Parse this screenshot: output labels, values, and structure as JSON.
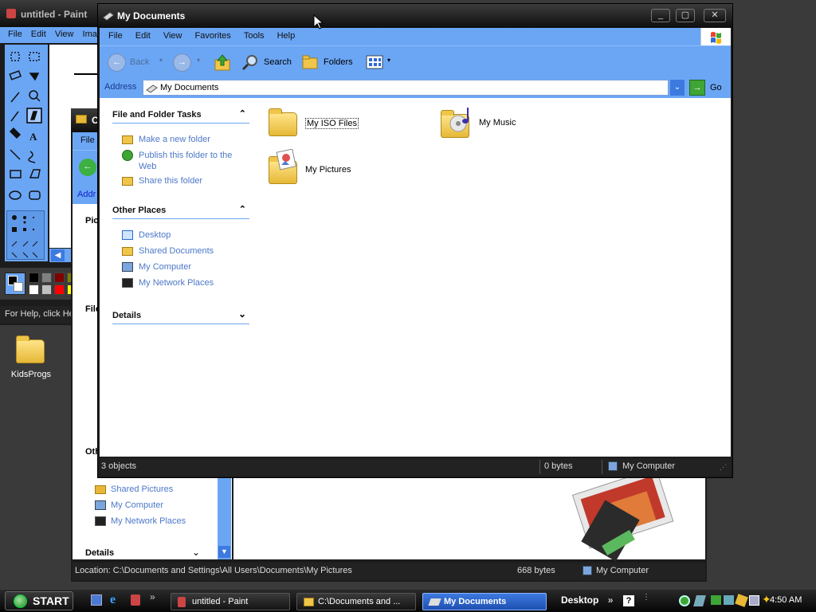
{
  "desktop": {
    "icon_label": "KidsProgs"
  },
  "paint": {
    "title": "untitled - Paint",
    "menu": [
      "File",
      "Edit",
      "View",
      "Ima"
    ],
    "status": "For Help, click He"
  },
  "back_window": {
    "title": "C",
    "menu_file": "File",
    "address_label": "Addr",
    "pict_label": "Pict",
    "file_label": "File",
    "other_label": "Oth",
    "other_places": [
      "Shared Pictures",
      "My Computer",
      "My Network Places"
    ],
    "details": "Details",
    "location": "Location: C:\\Documents and Settings\\All Users\\Documents\\My Pictures",
    "size": "668 bytes",
    "computer": "My Computer"
  },
  "main": {
    "title": "My Documents",
    "menu": [
      "File",
      "Edit",
      "View",
      "Favorites",
      "Tools",
      "Help"
    ],
    "toolbar": {
      "back": "Back",
      "search": "Search",
      "folders": "Folders"
    },
    "address": {
      "label": "Address",
      "value": "My Documents",
      "go": "Go"
    },
    "tasks": {
      "file_title": "File and Folder Tasks",
      "file_links": [
        "Make a new folder",
        "Publish this folder to the Web",
        "Share this folder"
      ],
      "other_title": "Other Places",
      "other_links": [
        "Desktop",
        "Shared Documents",
        "My Computer",
        "My Network Places"
      ],
      "details_title": "Details"
    },
    "items": [
      "My ISO Files",
      "My Music",
      "My Pictures"
    ],
    "status": {
      "objects": "3 objects",
      "size": "0 bytes",
      "computer": "My Computer"
    }
  },
  "taskbar": {
    "start": "START",
    "buttons": [
      "untitled - Paint",
      "C:\\Documents and ...",
      "My Documents"
    ],
    "desktop": "Desktop",
    "time": "4:50 AM"
  }
}
